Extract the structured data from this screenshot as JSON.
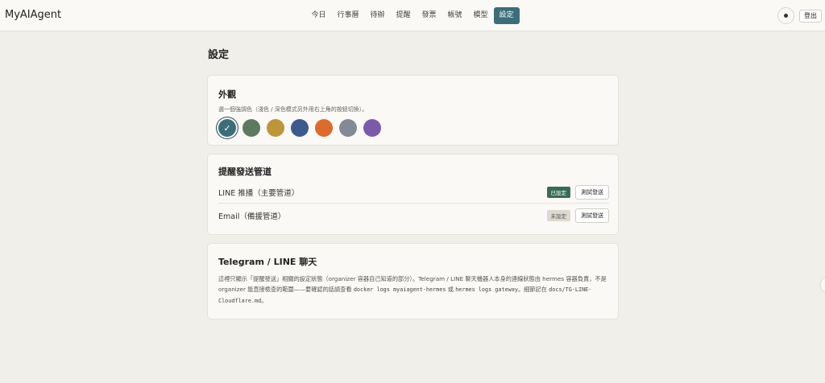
{
  "app": {
    "brand": "MyAIAgent",
    "logout_label": "登出"
  },
  "nav": {
    "items": [
      {
        "label": "今日"
      },
      {
        "label": "行事曆"
      },
      {
        "label": "待辦"
      },
      {
        "label": "提醒"
      },
      {
        "label": "發票"
      },
      {
        "label": "帳號"
      },
      {
        "label": "模型"
      },
      {
        "label": "設定",
        "active": true
      }
    ]
  },
  "page": {
    "title": "設定"
  },
  "appearance": {
    "title": "外觀",
    "hint": "選一個強調色（淺色 / 深色模式另外用右上角的按鈕切換）。",
    "selected_mark": "✓",
    "swatches": [
      {
        "color": "#3e6d7a",
        "selected": true
      },
      {
        "color": "#5c7a5f"
      },
      {
        "color": "#bd953b"
      },
      {
        "color": "#3d5a8f"
      },
      {
        "color": "#dd6b2e"
      },
      {
        "color": "#828a96"
      },
      {
        "color": "#7c5aab"
      }
    ]
  },
  "channels": {
    "title": "提醒發送管道",
    "rows": [
      {
        "name": "LINE 推播（主要管道）",
        "status": "已設定",
        "configured": true,
        "test_label": "測試發送"
      },
      {
        "name": "Email（備援管道）",
        "status": "未設定",
        "configured": false,
        "test_label": "測試發送"
      }
    ]
  },
  "telegram": {
    "title": "Telegram / LINE 聊天",
    "note_1": "這裡只顯示「提醒發送」相關的設定狀態（organizer 容器自己知道的部分）。Telegram / LINE 聊天機器人本身的連線狀態由 hermes 容器負責，不是 organizer 能直接檢查的範圍——要確認的話請查看 ",
    "code_1": "docker logs myaiagent-hermes",
    "note_2": " 或 ",
    "code_2": "hermes logs gateway",
    "note_3": "。細節記在 ",
    "code_3": "docs/TG-LINE-Cloudflare.md",
    "note_4": "。"
  },
  "colors": {
    "accent": "#3e6d7a",
    "ok_badge": "#3a6b55"
  }
}
